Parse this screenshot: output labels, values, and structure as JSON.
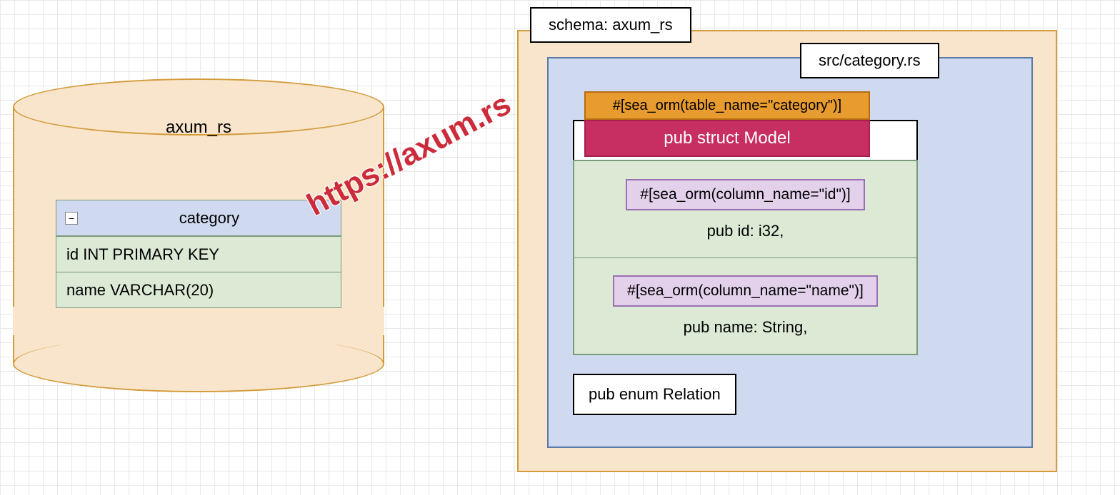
{
  "database": {
    "name": "axum_rs",
    "table": {
      "name": "category",
      "columns": [
        "id INT  PRIMARY KEY",
        "name VARCHAR(20)"
      ]
    }
  },
  "schema": {
    "label": "schema: axum_rs",
    "file": "src/category.rs",
    "table_annotation": "#[sea_orm(table_name=\"category\")]",
    "struct_name": "pub struct Model",
    "fields": [
      {
        "annotation": "#[sea_orm(column_name=\"id\")]",
        "decl": "pub id: i32,"
      },
      {
        "annotation": "#[sea_orm(column_name=\"name\")]",
        "decl": "pub name: String,"
      }
    ],
    "enum": "pub enum Relation"
  },
  "watermark": "https://axum.rs",
  "colors": {
    "orange_fill": "#f8e5cb",
    "orange_border": "#d39b3a",
    "blue_fill": "#cfdaf0",
    "blue_border": "#5b7aa8",
    "green_fill": "#dbe9d5",
    "purple_fill": "#e3d1ec",
    "magenta": "#c72e62",
    "amber": "#e89b2e"
  }
}
